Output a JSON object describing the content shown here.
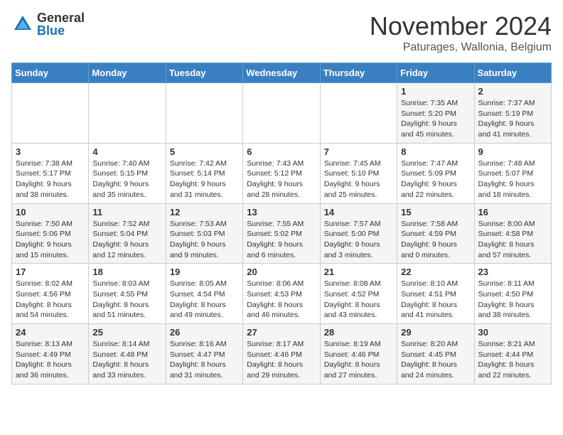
{
  "logo": {
    "general": "General",
    "blue": "Blue"
  },
  "title": "November 2024",
  "subtitle": "Paturages, Wallonia, Belgium",
  "days_of_week": [
    "Sunday",
    "Monday",
    "Tuesday",
    "Wednesday",
    "Thursday",
    "Friday",
    "Saturday"
  ],
  "weeks": [
    [
      {
        "day": "",
        "info": ""
      },
      {
        "day": "",
        "info": ""
      },
      {
        "day": "",
        "info": ""
      },
      {
        "day": "",
        "info": ""
      },
      {
        "day": "",
        "info": ""
      },
      {
        "day": "1",
        "info": "Sunrise: 7:35 AM\nSunset: 5:20 PM\nDaylight: 9 hours and 45 minutes."
      },
      {
        "day": "2",
        "info": "Sunrise: 7:37 AM\nSunset: 5:19 PM\nDaylight: 9 hours and 41 minutes."
      }
    ],
    [
      {
        "day": "3",
        "info": "Sunrise: 7:38 AM\nSunset: 5:17 PM\nDaylight: 9 hours and 38 minutes."
      },
      {
        "day": "4",
        "info": "Sunrise: 7:40 AM\nSunset: 5:15 PM\nDaylight: 9 hours and 35 minutes."
      },
      {
        "day": "5",
        "info": "Sunrise: 7:42 AM\nSunset: 5:14 PM\nDaylight: 9 hours and 31 minutes."
      },
      {
        "day": "6",
        "info": "Sunrise: 7:43 AM\nSunset: 5:12 PM\nDaylight: 9 hours and 28 minutes."
      },
      {
        "day": "7",
        "info": "Sunrise: 7:45 AM\nSunset: 5:10 PM\nDaylight: 9 hours and 25 minutes."
      },
      {
        "day": "8",
        "info": "Sunrise: 7:47 AM\nSunset: 5:09 PM\nDaylight: 9 hours and 22 minutes."
      },
      {
        "day": "9",
        "info": "Sunrise: 7:48 AM\nSunset: 5:07 PM\nDaylight: 9 hours and 18 minutes."
      }
    ],
    [
      {
        "day": "10",
        "info": "Sunrise: 7:50 AM\nSunset: 5:06 PM\nDaylight: 9 hours and 15 minutes."
      },
      {
        "day": "11",
        "info": "Sunrise: 7:52 AM\nSunset: 5:04 PM\nDaylight: 9 hours and 12 minutes."
      },
      {
        "day": "12",
        "info": "Sunrise: 7:53 AM\nSunset: 5:03 PM\nDaylight: 9 hours and 9 minutes."
      },
      {
        "day": "13",
        "info": "Sunrise: 7:55 AM\nSunset: 5:02 PM\nDaylight: 9 hours and 6 minutes."
      },
      {
        "day": "14",
        "info": "Sunrise: 7:57 AM\nSunset: 5:00 PM\nDaylight: 9 hours and 3 minutes."
      },
      {
        "day": "15",
        "info": "Sunrise: 7:58 AM\nSunset: 4:59 PM\nDaylight: 9 hours and 0 minutes."
      },
      {
        "day": "16",
        "info": "Sunrise: 8:00 AM\nSunset: 4:58 PM\nDaylight: 8 hours and 57 minutes."
      }
    ],
    [
      {
        "day": "17",
        "info": "Sunrise: 8:02 AM\nSunset: 4:56 PM\nDaylight: 8 hours and 54 minutes."
      },
      {
        "day": "18",
        "info": "Sunrise: 8:03 AM\nSunset: 4:55 PM\nDaylight: 8 hours and 51 minutes."
      },
      {
        "day": "19",
        "info": "Sunrise: 8:05 AM\nSunset: 4:54 PM\nDaylight: 8 hours and 49 minutes."
      },
      {
        "day": "20",
        "info": "Sunrise: 8:06 AM\nSunset: 4:53 PM\nDaylight: 8 hours and 46 minutes."
      },
      {
        "day": "21",
        "info": "Sunrise: 8:08 AM\nSunset: 4:52 PM\nDaylight: 8 hours and 43 minutes."
      },
      {
        "day": "22",
        "info": "Sunrise: 8:10 AM\nSunset: 4:51 PM\nDaylight: 8 hours and 41 minutes."
      },
      {
        "day": "23",
        "info": "Sunrise: 8:11 AM\nSunset: 4:50 PM\nDaylight: 8 hours and 38 minutes."
      }
    ],
    [
      {
        "day": "24",
        "info": "Sunrise: 8:13 AM\nSunset: 4:49 PM\nDaylight: 8 hours and 36 minutes."
      },
      {
        "day": "25",
        "info": "Sunrise: 8:14 AM\nSunset: 4:48 PM\nDaylight: 8 hours and 33 minutes."
      },
      {
        "day": "26",
        "info": "Sunrise: 8:16 AM\nSunset: 4:47 PM\nDaylight: 8 hours and 31 minutes."
      },
      {
        "day": "27",
        "info": "Sunrise: 8:17 AM\nSunset: 4:46 PM\nDaylight: 8 hours and 29 minutes."
      },
      {
        "day": "28",
        "info": "Sunrise: 8:19 AM\nSunset: 4:46 PM\nDaylight: 8 hours and 27 minutes."
      },
      {
        "day": "29",
        "info": "Sunrise: 8:20 AM\nSunset: 4:45 PM\nDaylight: 8 hours and 24 minutes."
      },
      {
        "day": "30",
        "info": "Sunrise: 8:21 AM\nSunset: 4:44 PM\nDaylight: 8 hours and 22 minutes."
      }
    ]
  ]
}
